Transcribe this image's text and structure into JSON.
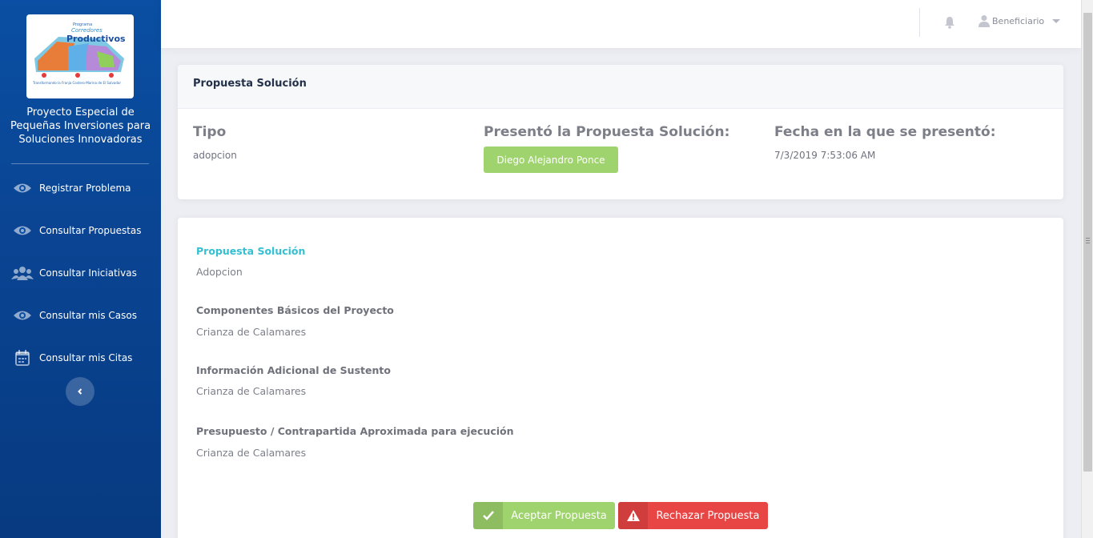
{
  "brand": {
    "logo_line1": "Programa",
    "logo_line2": "Corredores",
    "logo_line3": "Productivos",
    "logo_tagline": "Transformando la Franja Costero-Marina de El Salvador",
    "sidebar_title": "Proyecto Especial de Pequeñas Inversiones para Soluciones Innovadoras"
  },
  "sidebar": {
    "items": [
      {
        "label": "Registrar Problema",
        "icon": "eye-icon"
      },
      {
        "label": "Consultar Propuestas",
        "icon": "eye-icon"
      },
      {
        "label": "Consultar Iniciativas",
        "icon": "users-icon"
      },
      {
        "label": "Consultar mis Casos",
        "icon": "eye-icon"
      },
      {
        "label": "Consultar mis Citas",
        "icon": "calendar-icon"
      }
    ]
  },
  "header": {
    "user_label": "Beneficiario"
  },
  "summary": {
    "title": "Propuesta Solución",
    "tipo_label": "Tipo",
    "tipo_value": "adopcion",
    "presento_label": "Presentó la Propuesta Solución:",
    "presento_value": "Diego Alejandro Ponce",
    "fecha_label": "Fecha en la que se presentó:",
    "fecha_value": "7/3/2019 7:53:06 AM"
  },
  "details": {
    "propuesta_label": "Propuesta Solución",
    "propuesta_value": "Adopcion",
    "componentes_label": "Componentes Básicos del Proyecto",
    "componentes_value": "Crianza de Calamares",
    "informacion_label": "Información Adicional de Sustento",
    "informacion_value": "Crianza de Calamares",
    "presupuesto_label": "Presupuesto / Contrapartida Aproximada para ejecución",
    "presupuesto_value": "Crianza de Calamares"
  },
  "actions": {
    "accept_label": "Aceptar Propuesta",
    "reject_label": "Rechazar Propuesta"
  },
  "colors": {
    "sidebar": "#0a4fa3",
    "accent": "#34bfd3",
    "success": "#9fd36d",
    "danger": "#e84545"
  }
}
